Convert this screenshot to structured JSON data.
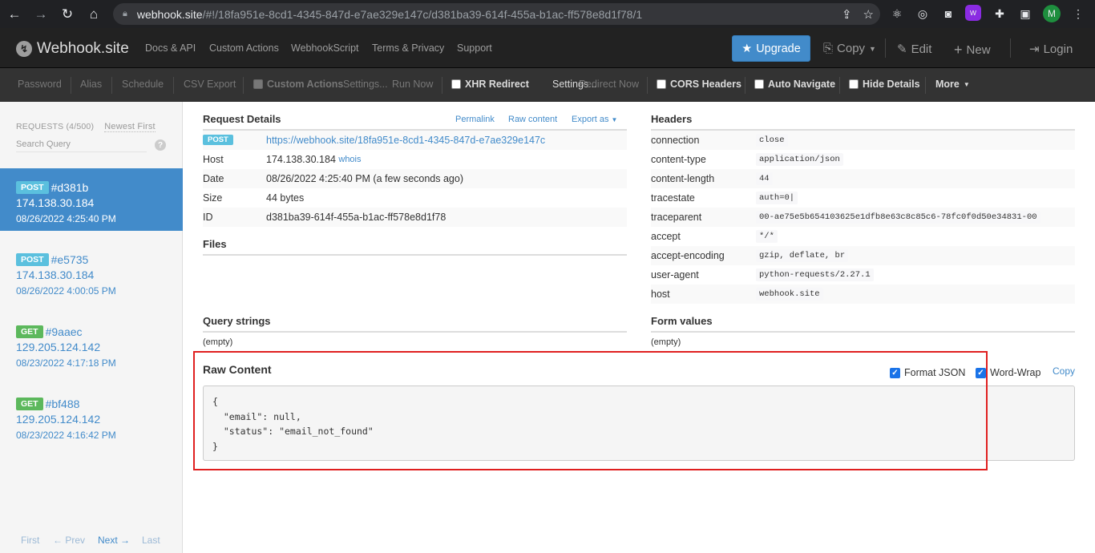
{
  "browser": {
    "url_domain": "webhook.site",
    "url_rest": "/#!/18fa951e-8cd1-4345-847d-e7ae329e147c/d381ba39-614f-455a-b1ac-ff578e8d1f78/1",
    "profile_initial": "M"
  },
  "navbar": {
    "brand": "Webhook.site",
    "links": [
      "Docs & API",
      "Custom Actions",
      "WebhookScript",
      "Terms & Privacy",
      "Support"
    ],
    "upgrade": "Upgrade",
    "copy": "Copy",
    "edit": "Edit",
    "new": "New",
    "login": "Login"
  },
  "toolbar": {
    "password": "Password",
    "alias": "Alias",
    "schedule": "Schedule",
    "csv_export": "CSV Export",
    "custom_actions": "Custom Actions",
    "settings1": "Settings...",
    "run_now": "Run Now",
    "xhr_redirect": "XHR Redirect",
    "settings2": "Settings...",
    "redirect_now": "Redirect Now",
    "cors_headers": "CORS Headers",
    "auto_navigate": "Auto Navigate",
    "hide_details": "Hide Details",
    "more": "More"
  },
  "sidebar": {
    "header": "REQUESTS (4/500)",
    "sort": "Newest First",
    "search_placeholder": "Search Query",
    "requests": [
      {
        "method": "POST",
        "id": "#d381b",
        "ip": "174.138.30.184",
        "date": "08/26/2022 4:25:40 PM"
      },
      {
        "method": "POST",
        "id": "#e5735",
        "ip": "174.138.30.184",
        "date": "08/26/2022 4:00:05 PM"
      },
      {
        "method": "GET",
        "id": "#9aaec",
        "ip": "129.205.124.142",
        "date": "08/23/2022 4:17:18 PM"
      },
      {
        "method": "GET",
        "id": "#bf488",
        "ip": "129.205.124.142",
        "date": "08/23/2022 4:16:42 PM"
      }
    ],
    "pager": {
      "first": "First",
      "prev": "← Prev",
      "next": "Next →",
      "last": "Last"
    }
  },
  "details": {
    "title": "Request Details",
    "permalink": "Permalink",
    "raw_content": "Raw content",
    "export_as": "Export as",
    "method": "POST",
    "url": "https://webhook.site/18fa951e-8cd1-4345-847d-e7ae329e147c",
    "host_label": "Host",
    "host": "174.138.30.184",
    "whois": "whois",
    "date_label": "Date",
    "date": "08/26/2022 4:25:40 PM (a few seconds ago)",
    "size_label": "Size",
    "size": "44 bytes",
    "id_label": "ID",
    "id": "d381ba39-614f-455a-b1ac-ff578e8d1f78"
  },
  "files": {
    "title": "Files"
  },
  "query_strings": {
    "title": "Query strings",
    "value": "(empty)"
  },
  "form_values": {
    "title": "Form values",
    "value": "(empty)"
  },
  "headers": {
    "title": "Headers",
    "items": [
      {
        "k": "connection",
        "v": "close"
      },
      {
        "k": "content-type",
        "v": "application/json"
      },
      {
        "k": "content-length",
        "v": "44"
      },
      {
        "k": "tracestate",
        "v": "auth=0|"
      },
      {
        "k": "traceparent",
        "v": "00-ae75e5b654103625e1dfb8e63c8c85c6-78fc0f0d50e34831-00"
      },
      {
        "k": "accept",
        "v": "*/*"
      },
      {
        "k": "accept-encoding",
        "v": "gzip, deflate, br"
      },
      {
        "k": "user-agent",
        "v": "python-requests/2.27.1"
      },
      {
        "k": "host",
        "v": "webhook.site"
      }
    ]
  },
  "raw": {
    "title": "Raw Content",
    "format_json": "Format JSON",
    "word_wrap": "Word-Wrap",
    "copy": "Copy",
    "body": "{\n  \"email\": null,\n  \"status\": \"email_not_found\"\n}"
  },
  "colors": {
    "accent": "#428bca",
    "highlight_box": "#e02020",
    "post_badge": "#5bc0de",
    "get_badge": "#5cb85c"
  }
}
